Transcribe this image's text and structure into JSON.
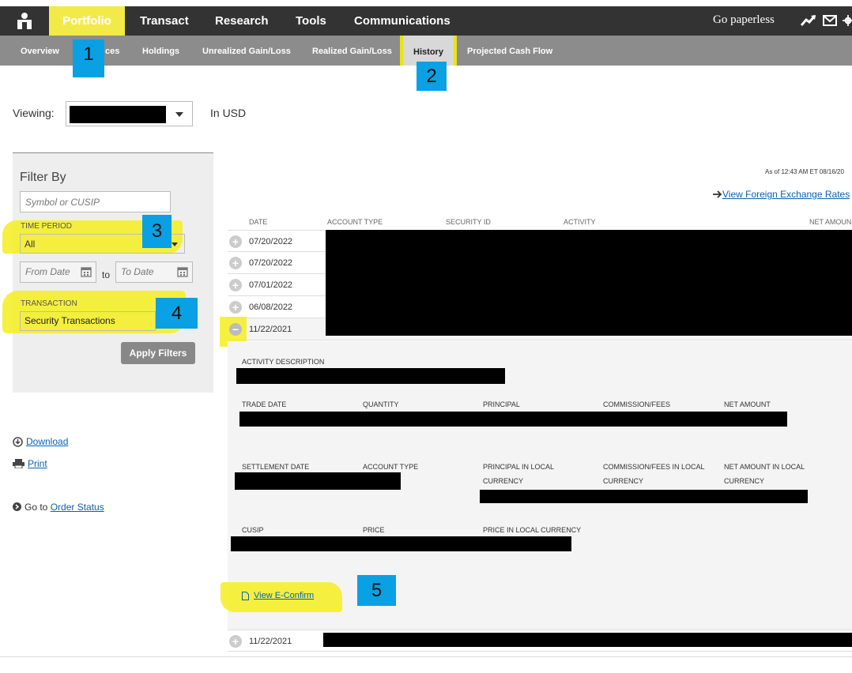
{
  "topnav": {
    "items": [
      {
        "label": "Portfolio"
      },
      {
        "label": "Transact"
      },
      {
        "label": "Research"
      },
      {
        "label": "Tools"
      },
      {
        "label": "Communications"
      }
    ],
    "go_paperless": "Go paperless"
  },
  "subnav": {
    "items": [
      {
        "label": "Overview"
      },
      {
        "label": "ces"
      },
      {
        "label": "Holdings"
      },
      {
        "label": "Unrealized Gain/Loss"
      },
      {
        "label": "Realized Gain/Loss"
      },
      {
        "label": "History"
      },
      {
        "label": "Projected Cash Flow"
      }
    ]
  },
  "annotations": [
    "1",
    "2",
    "3",
    "4",
    "5"
  ],
  "viewing": {
    "label": "Viewing:",
    "currency": "In USD"
  },
  "filter": {
    "title": "Filter By",
    "symbol_placeholder": "Symbol or CUSIP",
    "time_period_label": "TIME PERIOD",
    "time_period_value": "All",
    "from_placeholder": "From Date",
    "to_label": "to",
    "to_placeholder": "To Date",
    "transaction_label": "TRANSACTION",
    "transaction_value": "Security Transactions",
    "apply": "Apply Filters"
  },
  "links": {
    "download": "Download",
    "print": "Print",
    "goto_prefix": "Go to",
    "order_status": "Order Status",
    "fx_rates": "View Foreign Exchange Rates"
  },
  "asof": "As of 12:43 AM ET 08/16/20",
  "table": {
    "headers": [
      "DATE",
      "ACCOUNT TYPE",
      "SECURITY ID",
      "ACTIVITY",
      "NET AMOUN"
    ],
    "rows": [
      {
        "date": "07/20/2022"
      },
      {
        "date": "07/20/2022"
      },
      {
        "date": "07/01/2022"
      },
      {
        "date": "06/08/2022"
      },
      {
        "date": "11/22/2021"
      }
    ],
    "last_row_date": "11/22/2021"
  },
  "detail": {
    "activity_description": "ACTIVITY DESCRIPTION",
    "trade_date": "TRADE DATE",
    "quantity": "QUANTITY",
    "principal": "PRINCIPAL",
    "commission_fees": "COMMISSION/FEES",
    "net_amount": "NET AMOUNT",
    "settlement_date": "SETTLEMENT DATE",
    "account_type": "ACCOUNT TYPE",
    "principal_local_1": "PRINCIPAL IN LOCAL",
    "principal_local_2": "CURRENCY",
    "commission_local_1": "COMMISSION/FEES IN LOCAL",
    "commission_local_2": "CURRENCY",
    "net_local_1": "NET AMOUNT IN LOCAL",
    "net_local_2": "CURRENCY",
    "cusip": "CUSIP",
    "price": "PRICE",
    "price_local": "PRICE IN LOCAL CURRENCY",
    "view_econfirm": "View E-Confirm"
  },
  "colors": {
    "highlight": "#f4ee1e",
    "annotation": "#0aa0e4",
    "nav": "#333333",
    "subnav": "#8c8c8c",
    "link": "#0b5fb5"
  }
}
